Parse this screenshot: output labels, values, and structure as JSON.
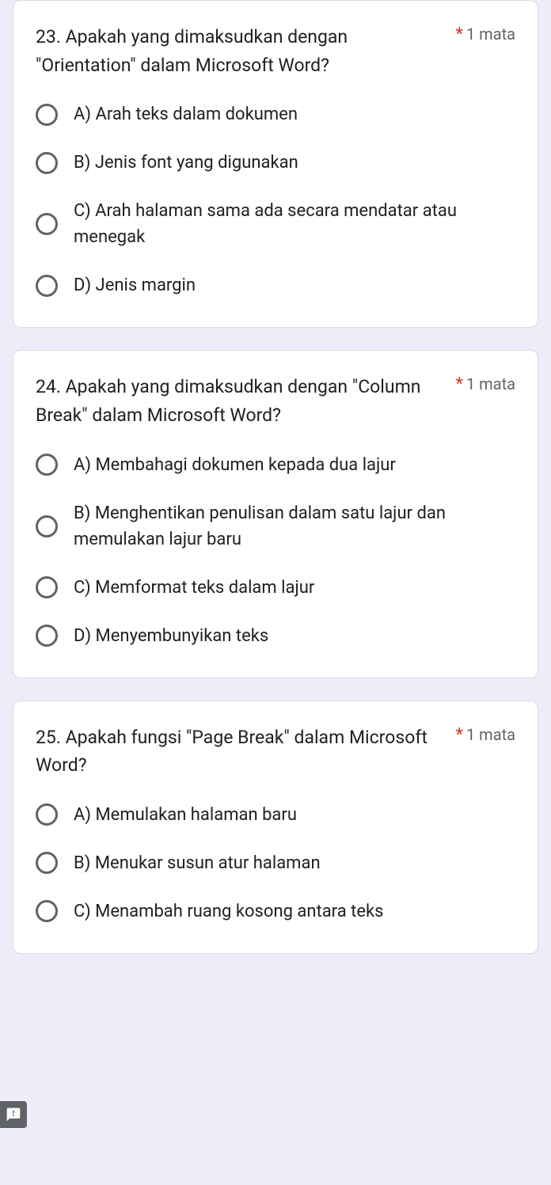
{
  "points_label": "1 mata",
  "questions": [
    {
      "title": "23. Apakah yang dimaksudkan dengan \"Orientation\" dalam Microsoft Word?",
      "options": [
        "A) Arah teks dalam dokumen",
        "B) Jenis font yang digunakan",
        "C) Arah halaman sama ada secara mendatar atau menegak",
        "D) Jenis margin"
      ]
    },
    {
      "title": "24. Apakah yang dimaksudkan dengan \"Column Break\" dalam Microsoft Word?",
      "options": [
        "A) Membahagi dokumen kepada dua lajur",
        "B) Menghentikan penulisan dalam satu lajur dan memulakan lajur baru",
        "C) Memformat teks dalam lajur",
        "D) Menyembunyikan teks"
      ]
    },
    {
      "title": "25. Apakah fungsi \"Page Break\" dalam Microsoft Word?",
      "options": [
        "A) Memulakan halaman baru",
        "B) Menukar susun atur halaman",
        "C) Menambah ruang kosong antara teks"
      ]
    }
  ]
}
